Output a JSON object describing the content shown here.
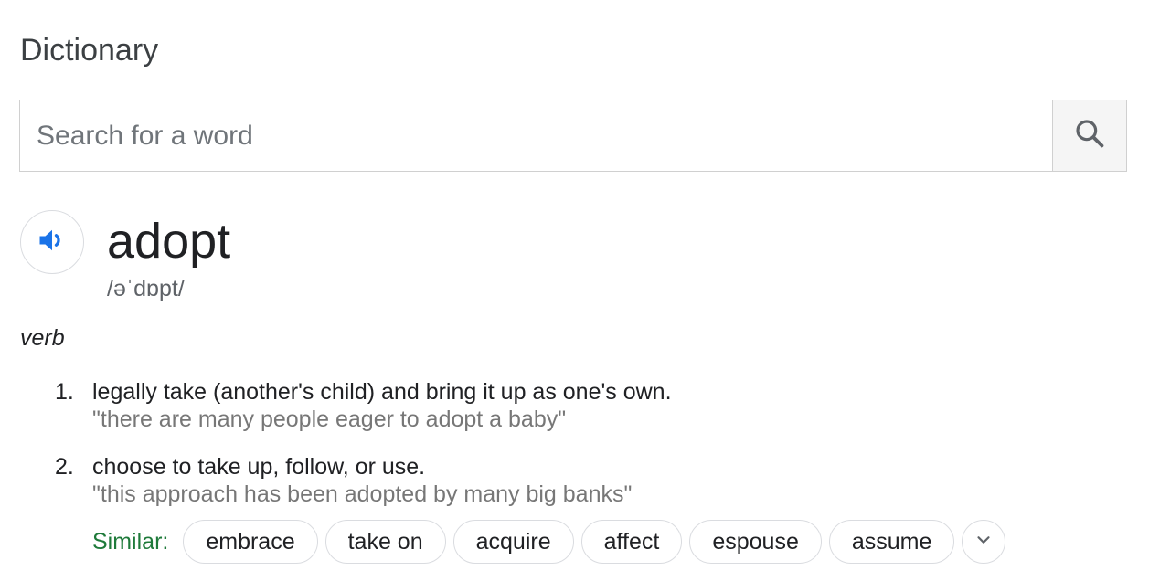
{
  "header": {
    "title": "Dictionary"
  },
  "search": {
    "placeholder": "Search for a word",
    "value": "",
    "button_icon": "search-icon"
  },
  "entry": {
    "audio_icon": "speaker-icon",
    "word": "adopt",
    "phonetic": "/əˈdɒpt/",
    "part_of_speech": "verb",
    "senses": [
      {
        "number": "1.",
        "definition": "legally take (another's child) and bring it up as one's own.",
        "example": "\"there are many people eager to adopt a baby\""
      },
      {
        "number": "2.",
        "definition": "choose to take up, follow, or use.",
        "example": "\"this approach has been adopted by many big banks\""
      }
    ],
    "similar": {
      "label": "Similar:",
      "words": [
        "embrace",
        "take on",
        "acquire",
        "affect",
        "espouse",
        "assume"
      ],
      "expand_icon": "chevron-down-icon"
    }
  },
  "colors": {
    "accent_blue": "#1a73e8",
    "similar_green": "#1e7a3a",
    "example_gray": "#777777"
  }
}
